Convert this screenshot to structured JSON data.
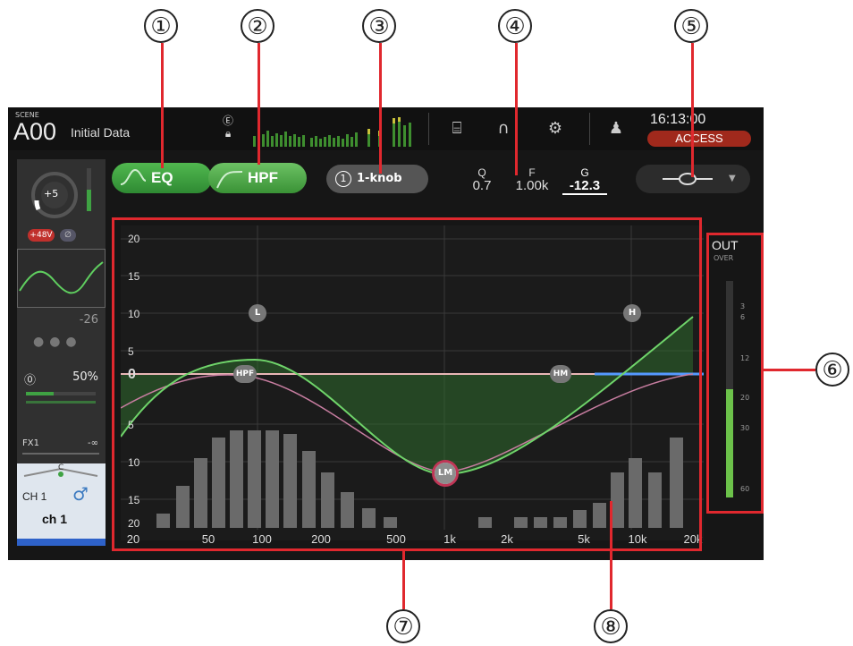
{
  "callouts": [
    "①",
    "②",
    "③",
    "④",
    "⑤",
    "⑥",
    "⑦",
    "⑧"
  ],
  "header": {
    "scene_label": "SCENE",
    "scene_number": "A00",
    "scene_name": "Initial Data",
    "clock": "16:13:00",
    "access_label": "ACCESS",
    "icons": [
      "recorder-icon",
      "headphones-icon",
      "gear-icon",
      "user-icon"
    ]
  },
  "channel": {
    "gain_value": "+5",
    "phantom_label": "+48V",
    "fader_value": "-26",
    "pan_percent": "50%",
    "fx_label": "FX1",
    "fx_value": "-∞",
    "pan_marker": "C",
    "ch_id": "CH 1",
    "ch_name": "ch 1"
  },
  "toolbar": {
    "eq_label": "EQ",
    "hpf_label": "HPF",
    "knob_mode_num": "1",
    "knob_mode_label": "1-knob",
    "q_label": "Q",
    "q_value": "0.7",
    "f_label": "F",
    "f_value": "1.00k",
    "g_label": "G",
    "g_value": "-12.3"
  },
  "graph": {
    "y_labels": [
      "20",
      "15",
      "10",
      "5",
      "0",
      "5",
      "10",
      "15",
      "20"
    ],
    "x_labels": [
      "20",
      "50",
      "100",
      "200",
      "500",
      "1k",
      "2k",
      "5k",
      "10k",
      "20k"
    ],
    "bands": [
      "L",
      "H",
      "HPF",
      "HM",
      "LM"
    ]
  },
  "out_meter": {
    "title": "OUT",
    "over_label": "OVER",
    "scale": [
      "3",
      "6",
      "12",
      "20",
      "30",
      "60"
    ],
    "level_fraction": 0.5
  },
  "colors": {
    "accent_green": "#3fa243",
    "red_annotation": "#e0282e",
    "access_red": "#a0291c"
  }
}
